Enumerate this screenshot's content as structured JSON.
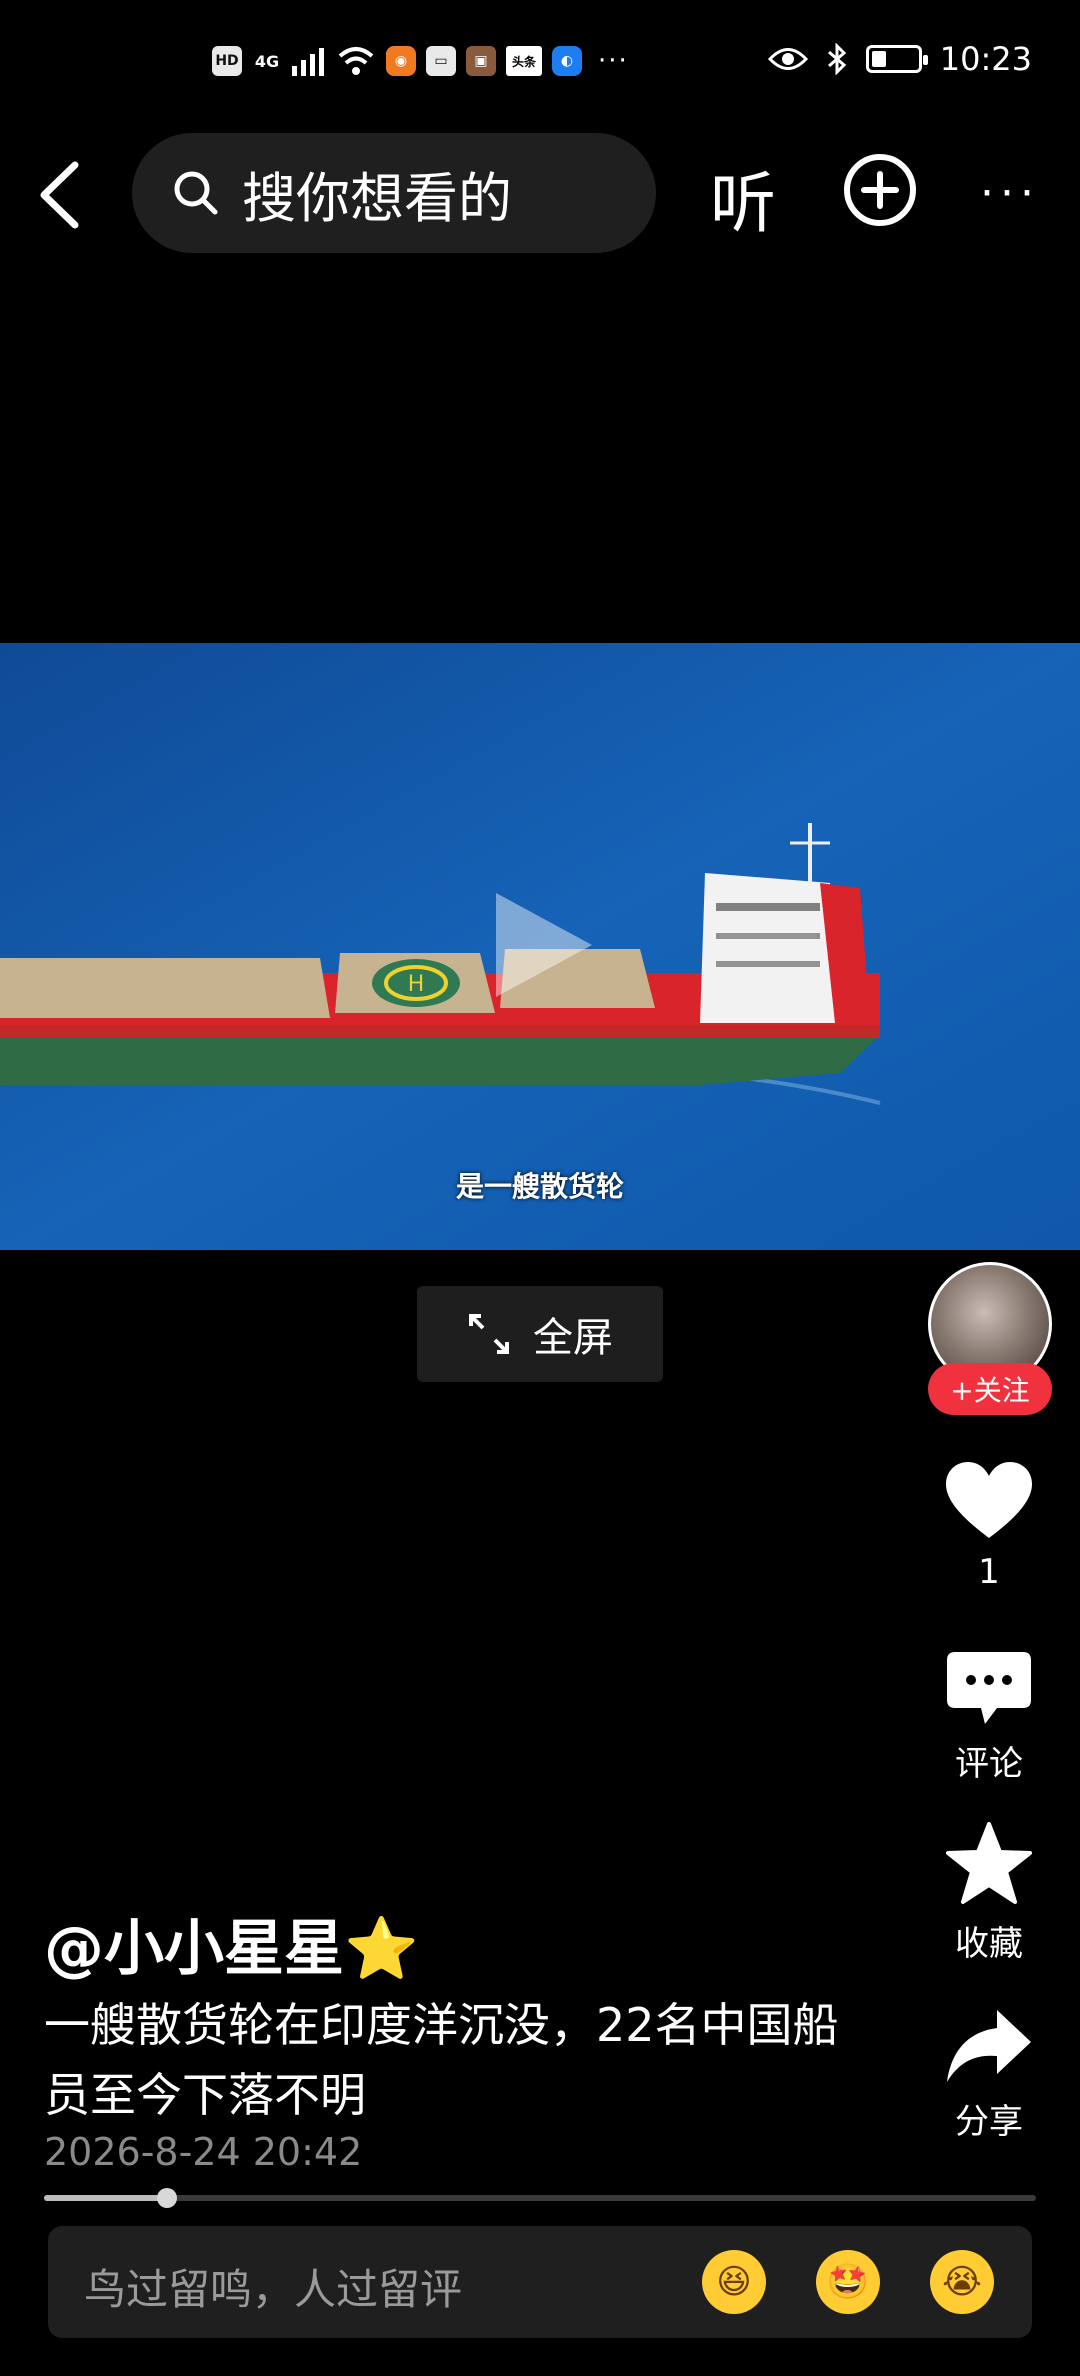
{
  "status_bar": {
    "left_icons": [
      "HD",
      "4G",
      "signal",
      "wifi",
      "app",
      "app",
      "app",
      "头条",
      "app",
      "…"
    ],
    "hd": "HD",
    "network": "4G",
    "toutiao": "头条",
    "dots": "···",
    "time": "10:23"
  },
  "nav": {
    "search_placeholder": "搜你想看的",
    "listen_label": "听"
  },
  "video": {
    "subtitle": "是一艘散货轮"
  },
  "fullscreen_label": "全屏",
  "rail": {
    "follow_label": "+关注",
    "like_count": "1",
    "comment_label": "评论",
    "favorite_label": "收藏",
    "share_label": "分享"
  },
  "post": {
    "author": "@小小星星⭐",
    "description": "一艘散货轮在印度洋沉没，22名中国船员至今下落不明",
    "date": "2026-8-24 20:42",
    "progress": 0.124
  },
  "comment_bar": {
    "placeholder": "鸟过留鸣，人过留评",
    "emojis": [
      "😆",
      "🤩",
      "😭"
    ]
  }
}
